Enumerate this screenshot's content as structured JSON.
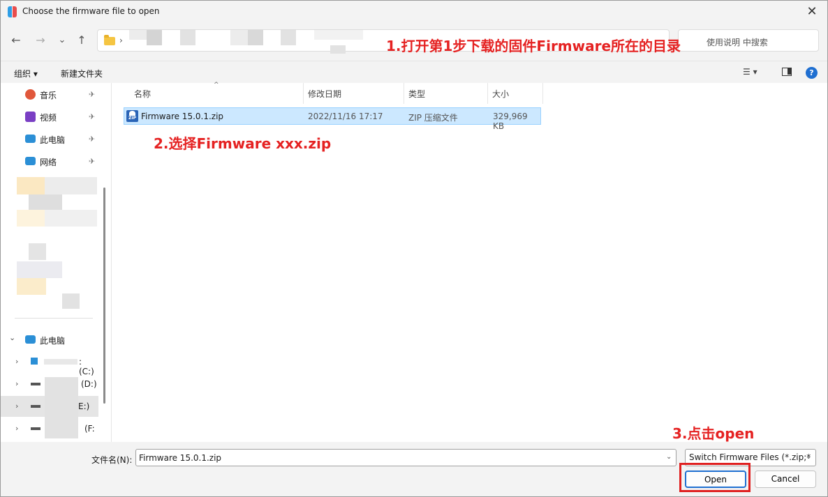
{
  "window": {
    "title": "Choose the firmware file to open",
    "close_glyph": "✕"
  },
  "nav": {
    "back_glyph": "←",
    "forward_glyph": "→",
    "recent_glyph": "⌄",
    "up_glyph": "↑",
    "address_chevron": "›",
    "address_dropdown_glyph": "⌄",
    "search_placeholder": "使用说明 中搜索"
  },
  "toolbar": {
    "organize_label": "组织 ▾",
    "new_folder_label": "新建文件夹",
    "view_glyph": "☰ ▾",
    "help_glyph": "?"
  },
  "sidebar": {
    "quick_items": [
      {
        "label": "音乐",
        "icon": "music-icon",
        "color": "#e0573b"
      },
      {
        "label": "视频",
        "icon": "video-icon",
        "color": "#7a3fc4"
      },
      {
        "label": "此电脑",
        "icon": "computer-icon",
        "color": "#2b8fd6"
      },
      {
        "label": "网络",
        "icon": "network-icon",
        "color": "#2b8fd6"
      }
    ],
    "pin_glyph": "📌",
    "this_pc_label": "此电脑",
    "expand_open_glyph": "⌄",
    "expand_closed_glyph": "›",
    "drives": [
      {
        "label": ": (C:)"
      },
      {
        "label": "(D:)"
      },
      {
        "label": "E:)"
      },
      {
        "label": "(F:"
      }
    ]
  },
  "columns": {
    "name": "名称",
    "date": "修改日期",
    "type": "类型",
    "size": "大小",
    "sort_glyph": "^"
  },
  "files": [
    {
      "name": "Firmware 15.0.1.zip",
      "date": "2022/11/16 17:17",
      "type": "ZIP 压缩文件",
      "size": "329,969 KB",
      "icon_text": "ZIP"
    }
  ],
  "bottom": {
    "filename_label": "文件名(N):",
    "filename_value": "Firmware 15.0.1.zip",
    "dropdown_glyph": "⌄",
    "filter_value": "Switch Firmware Files (*.zip;*",
    "open_label": "Open",
    "cancel_label": "Cancel"
  },
  "annotations": {
    "step1": "1.打开第1步下载的固件Firmware所在的目录",
    "step2": "2.选择Firmware xxx.zip",
    "step3": "3.点击open",
    "color": "#e52222"
  }
}
